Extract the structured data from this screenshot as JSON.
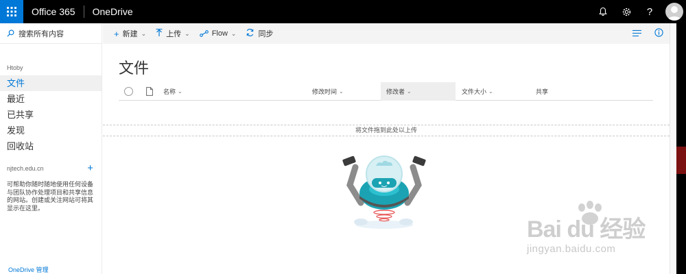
{
  "suite": {
    "brand": "Office 365",
    "app_name": "OneDrive",
    "icons": [
      "waffle-icon",
      "bell-icon",
      "gear-icon",
      "help-icon",
      "avatar"
    ]
  },
  "leftnav": {
    "search_placeholder": "搜索所有内容",
    "site_label": "Htoby",
    "items": [
      {
        "label": "文件",
        "active": true
      },
      {
        "label": "最近"
      },
      {
        "label": "已共享"
      },
      {
        "label": "发现"
      },
      {
        "label": "回收站"
      }
    ],
    "site_domain": "njtech.edu.cn",
    "help_text": "可帮助你随时随地使用任何设备与团队协作处理项目和共享信息的网站。创建或关注网站可将其显示在这里。",
    "manage_link": "OneDrive 管理"
  },
  "cmdbar": {
    "new_label": "新建",
    "upload_label": "上传",
    "flow_label": "Flow",
    "sync_label": "同步"
  },
  "main": {
    "title": "文件",
    "columns": {
      "name": "名称",
      "modified": "修改时间",
      "modified_by": "修改者",
      "size": "文件大小",
      "sharing": "共享"
    },
    "dropzone_text": "将文件拖到此处以上传"
  },
  "watermark": {
    "main": "Bai du 经验",
    "sub": "jingyan.baidu.com"
  },
  "colors": {
    "accent": "#0078d7",
    "suitebar": "#000000",
    "robot_teal": "#1ba3b3"
  }
}
